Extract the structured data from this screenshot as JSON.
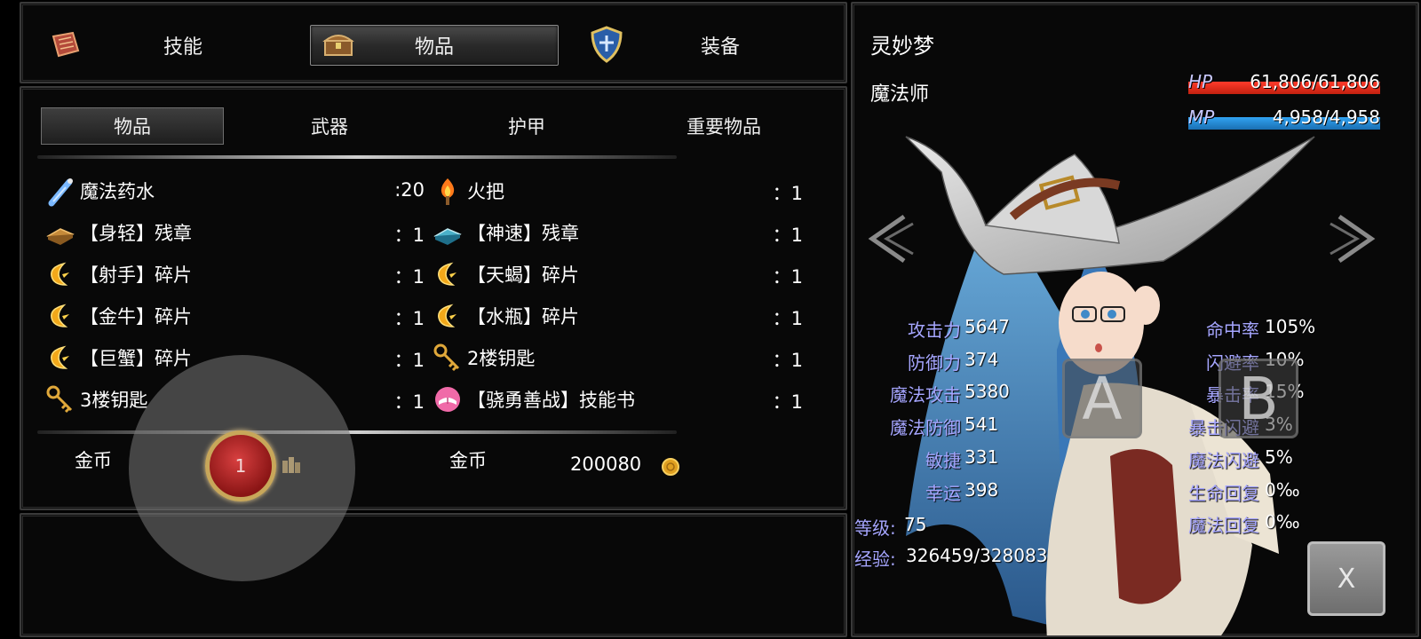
{
  "top_tabs": {
    "skills": "技能",
    "items": "物品",
    "equipment": "装备"
  },
  "sub_tabs": [
    "物品",
    "武器",
    "护甲",
    "重要物品"
  ],
  "items_left": [
    {
      "name": "魔法药水",
      "qty": ":20",
      "icon": "potion-icon"
    },
    {
      "name": "【身轻】残章",
      "qty": "：1",
      "icon": "brown-book-icon"
    },
    {
      "name": "【射手】碎片",
      "qty": "：1",
      "icon": "shard-icon"
    },
    {
      "name": "【金牛】碎片",
      "qty": "：1",
      "icon": "shard-icon"
    },
    {
      "name": "【巨蟹】碎片",
      "qty": "：1",
      "icon": "shard-icon"
    },
    {
      "name": "3楼钥匙",
      "qty": "：1",
      "icon": "key-icon"
    }
  ],
  "items_right": [
    {
      "name": "火把",
      "qty": "：1",
      "icon": "torch-icon"
    },
    {
      "name": "【神速】残章",
      "qty": "：1",
      "icon": "blue-book-icon"
    },
    {
      "name": "【天蝎】碎片",
      "qty": "：1",
      "icon": "shard-icon"
    },
    {
      "name": "【水瓶】碎片",
      "qty": "：1",
      "icon": "shard-icon"
    },
    {
      "name": "2楼钥匙",
      "qty": "：1",
      "icon": "key-icon"
    },
    {
      "name": "【骁勇善战】技能书",
      "qty": "：1",
      "icon": "skill-book-icon"
    }
  ],
  "gold": {
    "left_label": "金币",
    "right_label": "金币",
    "right_value": "200080"
  },
  "joystick": {
    "value": "1"
  },
  "character": {
    "name": "灵妙梦",
    "class": "魔法师",
    "hp_label": "HP",
    "hp_value": "61,806/61,806",
    "hp_fraction": 1.0,
    "mp_label": "MP",
    "mp_value": "4,958/4,958",
    "mp_fraction": 1.0,
    "stats_left": [
      {
        "label": "攻击力",
        "value": "5647"
      },
      {
        "label": "防御力",
        "value": "374"
      },
      {
        "label": "魔法攻击",
        "value": "5380"
      },
      {
        "label": "魔法防御",
        "value": "541"
      },
      {
        "label": "敏捷",
        "value": "331"
      },
      {
        "label": "幸运",
        "value": "398"
      }
    ],
    "level_label": "等级:",
    "level_value": "75",
    "exp_label": "经验:",
    "exp_value": "326459/328083",
    "stats_right": [
      {
        "label": "命中率",
        "value": "105%"
      },
      {
        "label": "闪避率",
        "value": "10%"
      },
      {
        "label": "暴击率",
        "value": "15%"
      },
      {
        "label": "暴击闪避",
        "value": "3%"
      },
      {
        "label": "魔法闪避",
        "value": "5%"
      },
      {
        "label": "生命回复",
        "value": "0‰"
      },
      {
        "label": "魔法回复",
        "value": "0‰"
      }
    ]
  },
  "buttons": {
    "a": "A",
    "b": "B",
    "close": "X"
  },
  "colors": {
    "hp": "#e8321f",
    "mp": "#2790d8",
    "stat_label": "#a6a6ff",
    "accent_gold": "#c8a75a"
  }
}
